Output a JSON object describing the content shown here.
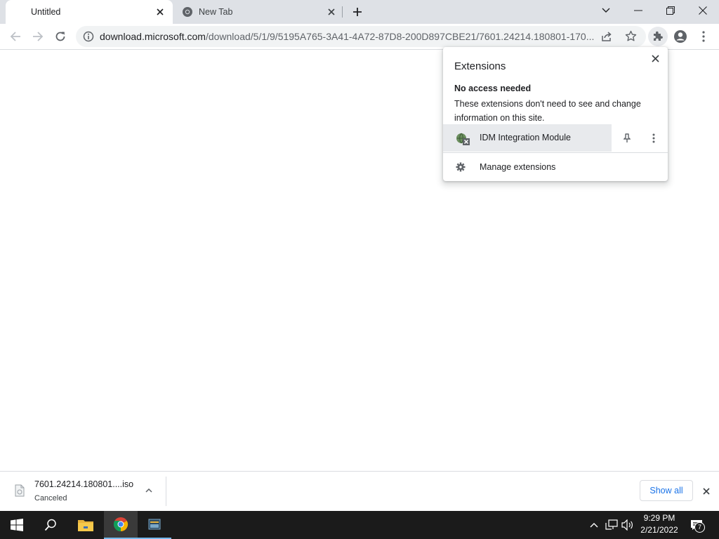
{
  "browser": {
    "tabs": [
      {
        "title": "Untitled",
        "active": true
      },
      {
        "title": "New Tab",
        "active": false
      }
    ],
    "address_bar": {
      "host": "download.microsoft.com",
      "path": "/download/5/1/9/5195A765-3A41-4A72-87D8-200D897CBE21/7601.24214.180801-170..."
    }
  },
  "extensions_popup": {
    "title": "Extensions",
    "section_heading": "No access needed",
    "section_description": "These extensions don't need to see and change information on this site.",
    "extension_name": "IDM Integration Module",
    "manage_label": "Manage extensions"
  },
  "download_shelf": {
    "file_name": "7601.24214.180801....iso",
    "status": "Canceled",
    "show_all_label": "Show all"
  },
  "taskbar": {
    "time": "9:29 PM",
    "date": "2/21/2022",
    "notification_count": "7"
  },
  "colors": {
    "tab_strip": "#dee1e6",
    "accent_blue": "#1a73e8",
    "taskbar": "#1b1b1b"
  }
}
